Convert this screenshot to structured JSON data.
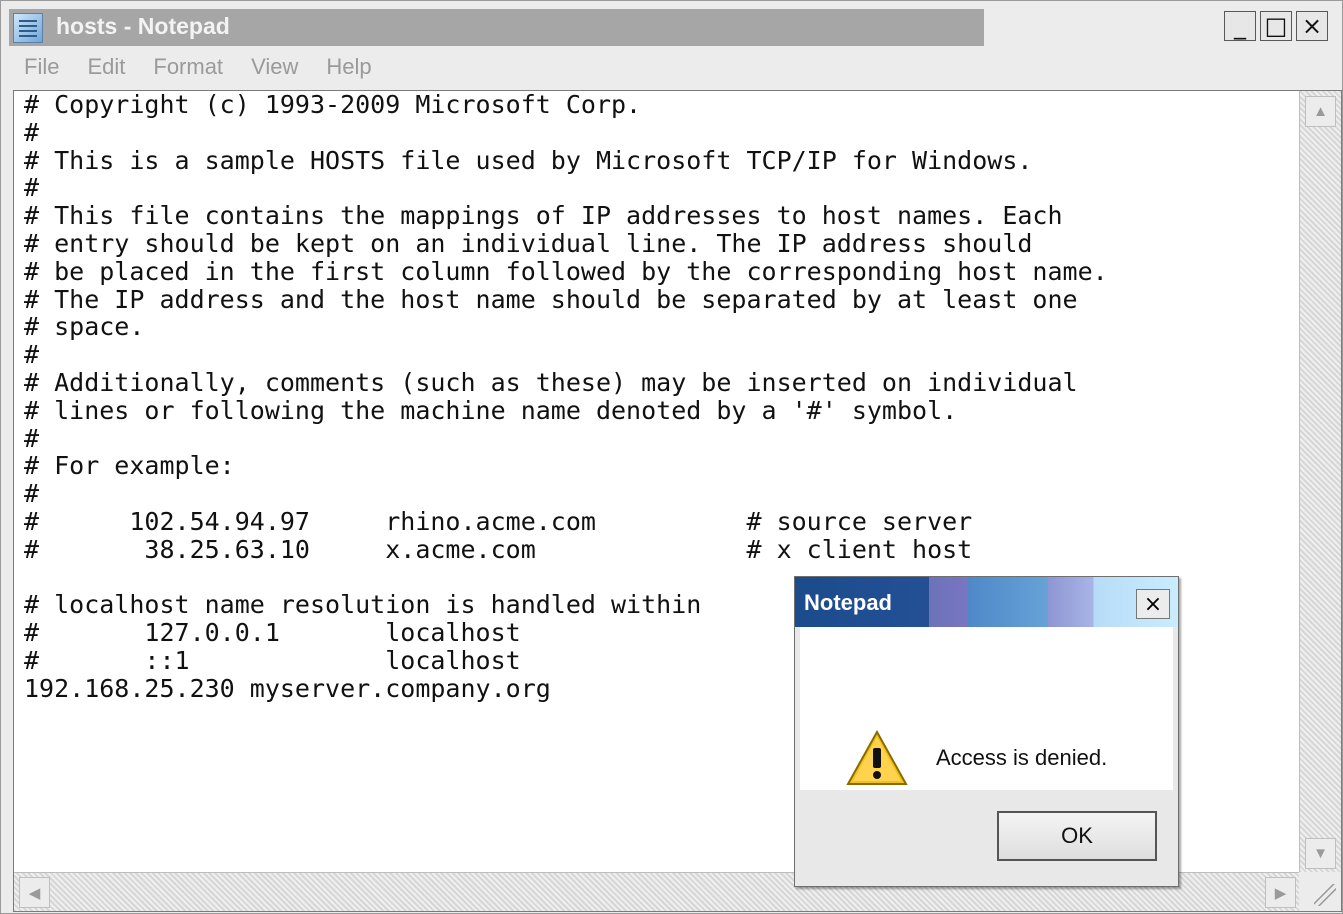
{
  "window": {
    "title": "hosts - Notepad",
    "controls": {
      "minimize": "_",
      "maximize": "□",
      "close": "×"
    }
  },
  "menu": [
    {
      "label": "File"
    },
    {
      "label": "Edit"
    },
    {
      "label": "Format"
    },
    {
      "label": "View"
    },
    {
      "label": "Help"
    }
  ],
  "editor": {
    "content": "# Copyright (c) 1993-2009 Microsoft Corp.\n#\n# This is a sample HOSTS file used by Microsoft TCP/IP for Windows.\n#\n# This file contains the mappings of IP addresses to host names. Each\n# entry should be kept on an individual line. The IP address should\n# be placed in the first column followed by the corresponding host name.\n# The IP address and the host name should be separated by at least one\n# space.\n#\n# Additionally, comments (such as these) may be inserted on individual\n# lines or following the machine name denoted by a '#' symbol.\n#\n# For example:\n#\n#      102.54.94.97     rhino.acme.com          # source server\n#       38.25.63.10     x.acme.com              # x client host\n\n# localhost name resolution is handled within\n#       127.0.0.1       localhost\n#       ::1             localhost\n192.168.25.230 myserver.company.org"
  },
  "dialog": {
    "title": "Notepad",
    "message": "Access is denied.",
    "ok_label": "OK",
    "close_label": "×"
  },
  "icons": {
    "window": "notepad-icon",
    "warning": "warning-icon"
  }
}
